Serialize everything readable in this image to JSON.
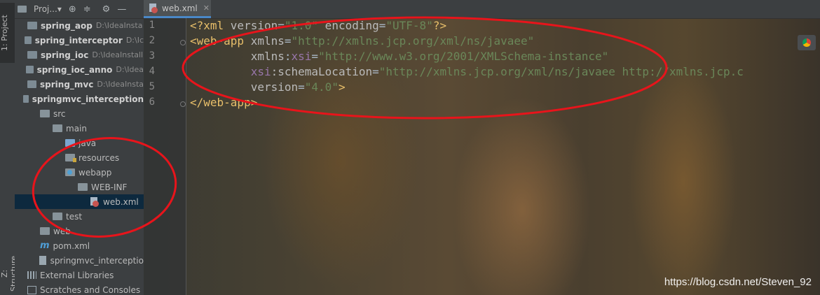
{
  "tool_strip": {
    "project_tab": "1: Project",
    "structure_tab": "Z: Structure"
  },
  "project_panel": {
    "title": "Proj...",
    "dropdown_glyph": "▾"
  },
  "tree": [
    {
      "label": "spring_aop",
      "path": "D:\\IdeaInsta",
      "kind": "module",
      "bold": true,
      "arrow": "▶",
      "indent": 0
    },
    {
      "label": "spring_interceptor",
      "path": "D:\\Ic",
      "kind": "module",
      "bold": true,
      "arrow": "▶",
      "indent": 0
    },
    {
      "label": "spring_ioc",
      "path": "D:\\IdeaInstall",
      "kind": "module",
      "bold": true,
      "arrow": "▶",
      "indent": 0
    },
    {
      "label": "spring_ioc_anno",
      "path": "D:\\Idea",
      "kind": "module",
      "bold": true,
      "arrow": "▶",
      "indent": 0
    },
    {
      "label": "spring_mvc",
      "path": "D:\\IdeaInsta",
      "kind": "module",
      "bold": true,
      "arrow": "▶",
      "indent": 0
    },
    {
      "label": "springmvc_interception",
      "path": "",
      "kind": "module",
      "bold": true,
      "arrow": "▼",
      "indent": 0
    },
    {
      "label": "src",
      "path": "",
      "kind": "folder",
      "bold": false,
      "arrow": "▼",
      "indent": 1
    },
    {
      "label": "main",
      "path": "",
      "kind": "folder",
      "bold": false,
      "arrow": "▼",
      "indent": 2
    },
    {
      "label": "java",
      "path": "",
      "kind": "java",
      "bold": false,
      "arrow": "▶",
      "indent": 3
    },
    {
      "label": "resources",
      "path": "",
      "kind": "res",
      "bold": false,
      "arrow": "▶",
      "indent": 3
    },
    {
      "label": "webapp",
      "path": "",
      "kind": "web",
      "bold": false,
      "arrow": "▼",
      "indent": 3
    },
    {
      "label": "WEB-INF",
      "path": "",
      "kind": "folder",
      "bold": false,
      "arrow": "▼",
      "indent": 4
    },
    {
      "label": "web.xml",
      "path": "",
      "kind": "xml",
      "bold": false,
      "arrow": "",
      "indent": 5,
      "selected": true
    },
    {
      "label": "test",
      "path": "",
      "kind": "folder",
      "bold": false,
      "arrow": "▶",
      "indent": 2
    },
    {
      "label": "web",
      "path": "",
      "kind": "folder",
      "bold": false,
      "arrow": "",
      "indent": 1
    },
    {
      "label": "pom.xml",
      "path": "",
      "kind": "maven",
      "bold": false,
      "arrow": "",
      "indent": 1
    },
    {
      "label": "springmvc_interceptio",
      "path": "",
      "kind": "iml",
      "bold": false,
      "arrow": "",
      "indent": 1
    },
    {
      "label": "External Libraries",
      "path": "",
      "kind": "lib",
      "bold": false,
      "arrow": "▶",
      "indent": 0
    },
    {
      "label": "Scratches and Consoles",
      "path": "",
      "kind": "scratch",
      "bold": false,
      "arrow": "",
      "indent": 0
    }
  ],
  "editor": {
    "tab_label": "web.xml",
    "line_numbers": [
      "1",
      "2",
      "3",
      "4",
      "5",
      "6"
    ],
    "lines": [
      [
        {
          "t": "<?xml ",
          "c": "t-tag"
        },
        {
          "t": "version",
          "c": "t-attr"
        },
        {
          "t": "=",
          "c": "t-plain"
        },
        {
          "t": "\"1.0\"",
          "c": "t-val"
        },
        {
          "t": " encoding",
          "c": "t-attr"
        },
        {
          "t": "=",
          "c": "t-plain"
        },
        {
          "t": "\"UTF-8\"",
          "c": "t-val"
        },
        {
          "t": "?>",
          "c": "t-tag"
        }
      ],
      [
        {
          "t": "<web-app ",
          "c": "t-tag"
        },
        {
          "t": "xmlns",
          "c": "t-attr"
        },
        {
          "t": "=",
          "c": "t-plain"
        },
        {
          "t": "\"http://xmlns.jcp.org/xml/ns/javaee\"",
          "c": "t-val"
        }
      ],
      [
        {
          "t": "         ",
          "c": "t-plain"
        },
        {
          "t": "xmlns",
          "c": "t-attr"
        },
        {
          "t": ":",
          "c": "t-plain"
        },
        {
          "t": "xsi",
          "c": "t-ns"
        },
        {
          "t": "=",
          "c": "t-plain"
        },
        {
          "t": "\"http://www.w3.org/2001/XMLSchema-instance\"",
          "c": "t-val"
        }
      ],
      [
        {
          "t": "         ",
          "c": "t-plain"
        },
        {
          "t": "xsi",
          "c": "t-ns"
        },
        {
          "t": ":schemaLocation",
          "c": "t-attr"
        },
        {
          "t": "=",
          "c": "t-plain"
        },
        {
          "t": "\"http://xmlns.jcp.org/xml/ns/javaee http://xmlns.jcp.c",
          "c": "t-val"
        }
      ],
      [
        {
          "t": "         ",
          "c": "t-plain"
        },
        {
          "t": "version",
          "c": "t-attr"
        },
        {
          "t": "=",
          "c": "t-plain"
        },
        {
          "t": "\"4.0\"",
          "c": "t-val"
        },
        {
          "t": ">",
          "c": "t-tag"
        }
      ],
      [
        {
          "t": "</web-app>",
          "c": "t-tag"
        }
      ]
    ]
  },
  "watermark": "https://blog.csdn.net/Steven_92",
  "colors": {
    "annotation_red": "#e8141b",
    "selection": "#0d293e",
    "tag": "#e8bf6a",
    "string": "#6a8759"
  }
}
